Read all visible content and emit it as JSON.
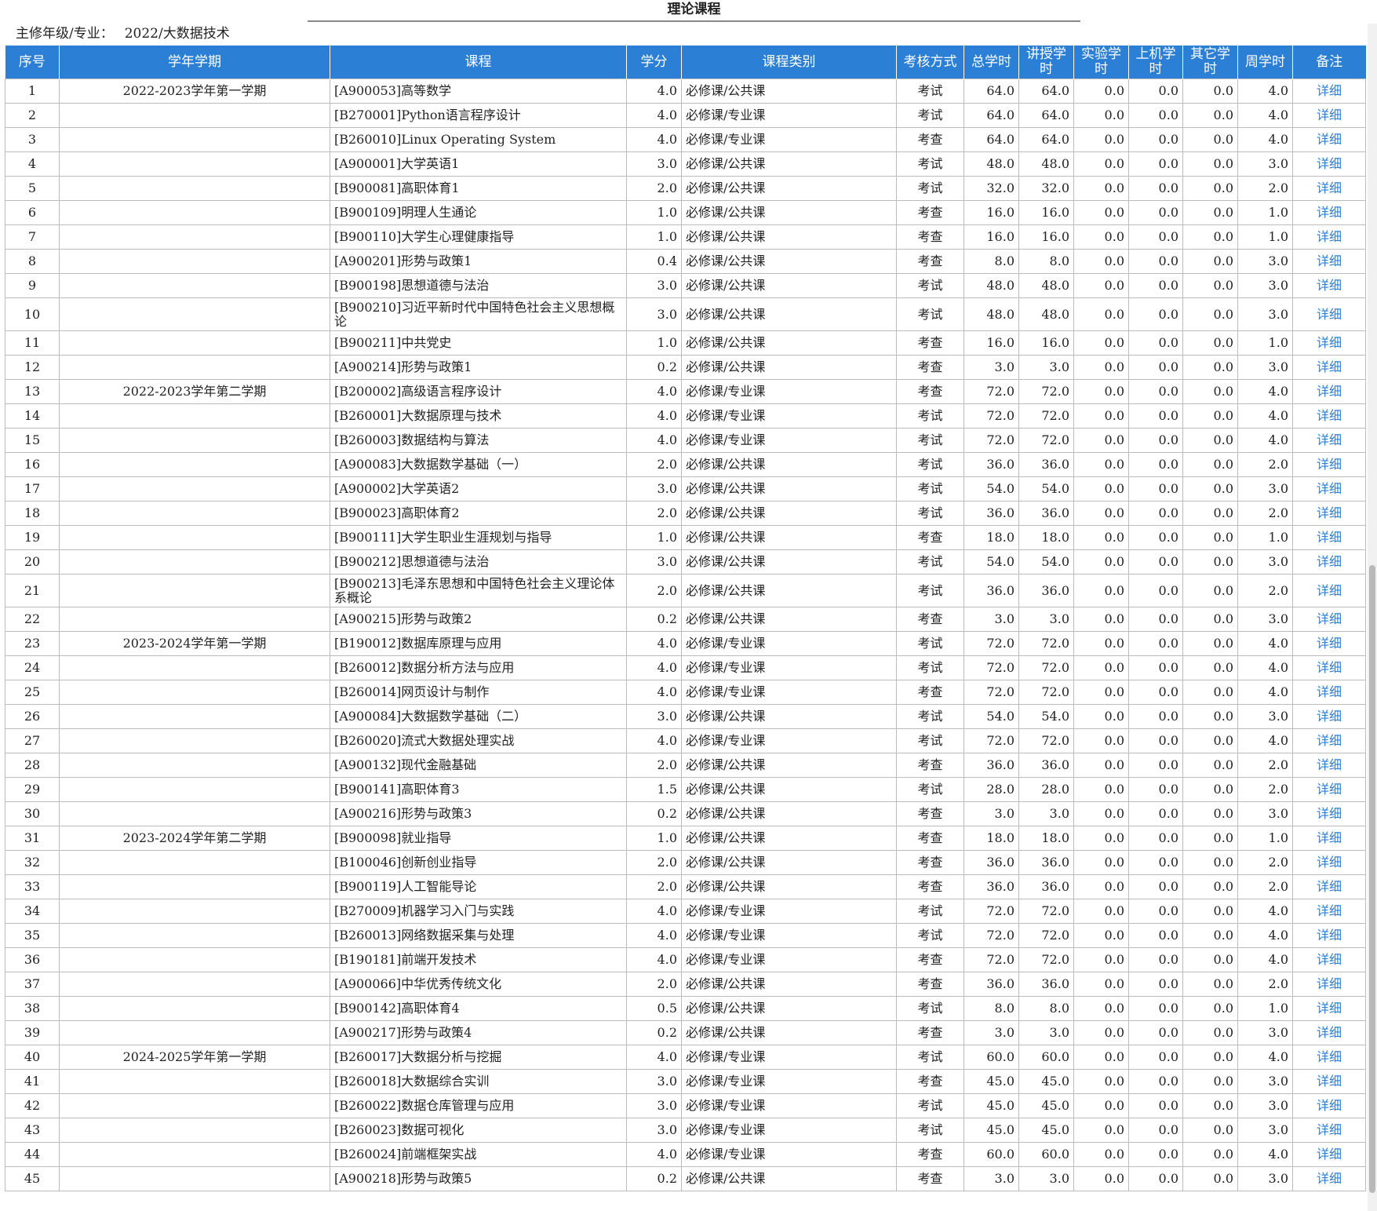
{
  "title": "理论课程",
  "meta": {
    "label": "主修年级/专业：",
    "value": "2022/大数据技术"
  },
  "columns": {
    "no": "序号",
    "semester": "学年学期",
    "course": "课程",
    "credit": "学分",
    "category": "课程类别",
    "exam": "考核方式",
    "total": "总学时",
    "lecture": "讲授学时",
    "lab": "实验学时",
    "computer": "上机学时",
    "other": "其它学时",
    "weekly": "周学时",
    "remark": "备注"
  },
  "detail_label": "详细",
  "rows": [
    {
      "no": "1",
      "semester": "2022-2023学年第一学期",
      "course": "[A900053]高等数学",
      "credit": "4.0",
      "category": "必修课/公共课",
      "exam": "考试",
      "total": "64.0",
      "lecture": "64.0",
      "lab": "0.0",
      "computer": "0.0",
      "other": "0.0",
      "weekly": "4.0"
    },
    {
      "no": "2",
      "semester": "",
      "course": "[B270001]Python语言程序设计",
      "credit": "4.0",
      "category": "必修课/专业课",
      "exam": "考试",
      "total": "64.0",
      "lecture": "64.0",
      "lab": "0.0",
      "computer": "0.0",
      "other": "0.0",
      "weekly": "4.0"
    },
    {
      "no": "3",
      "semester": "",
      "course": "[B260010]Linux Operating System",
      "credit": "4.0",
      "category": "必修课/专业课",
      "exam": "考查",
      "total": "64.0",
      "lecture": "64.0",
      "lab": "0.0",
      "computer": "0.0",
      "other": "0.0",
      "weekly": "4.0"
    },
    {
      "no": "4",
      "semester": "",
      "course": "[A900001]大学英语1",
      "credit": "3.0",
      "category": "必修课/公共课",
      "exam": "考试",
      "total": "48.0",
      "lecture": "48.0",
      "lab": "0.0",
      "computer": "0.0",
      "other": "0.0",
      "weekly": "3.0"
    },
    {
      "no": "5",
      "semester": "",
      "course": "[B900081]高职体育1",
      "credit": "2.0",
      "category": "必修课/公共课",
      "exam": "考试",
      "total": "32.0",
      "lecture": "32.0",
      "lab": "0.0",
      "computer": "0.0",
      "other": "0.0",
      "weekly": "2.0"
    },
    {
      "no": "6",
      "semester": "",
      "course": "[B900109]明理人生通论",
      "credit": "1.0",
      "category": "必修课/公共课",
      "exam": "考查",
      "total": "16.0",
      "lecture": "16.0",
      "lab": "0.0",
      "computer": "0.0",
      "other": "0.0",
      "weekly": "1.0"
    },
    {
      "no": "7",
      "semester": "",
      "course": "[B900110]大学生心理健康指导",
      "credit": "1.0",
      "category": "必修课/公共课",
      "exam": "考查",
      "total": "16.0",
      "lecture": "16.0",
      "lab": "0.0",
      "computer": "0.0",
      "other": "0.0",
      "weekly": "1.0"
    },
    {
      "no": "8",
      "semester": "",
      "course": "[A900201]形势与政策1",
      "credit": "0.4",
      "category": "必修课/公共课",
      "exam": "考查",
      "total": "8.0",
      "lecture": "8.0",
      "lab": "0.0",
      "computer": "0.0",
      "other": "0.0",
      "weekly": "3.0"
    },
    {
      "no": "9",
      "semester": "",
      "course": "[B900198]思想道德与法治",
      "credit": "3.0",
      "category": "必修课/公共课",
      "exam": "考试",
      "total": "48.0",
      "lecture": "48.0",
      "lab": "0.0",
      "computer": "0.0",
      "other": "0.0",
      "weekly": "3.0"
    },
    {
      "no": "10",
      "semester": "",
      "course": "[B900210]习近平新时代中国特色社会主义思想概论",
      "credit": "3.0",
      "category": "必修课/公共课",
      "exam": "考试",
      "total": "48.0",
      "lecture": "48.0",
      "lab": "0.0",
      "computer": "0.0",
      "other": "0.0",
      "weekly": "3.0",
      "tall": true
    },
    {
      "no": "11",
      "semester": "",
      "course": "[B900211]中共党史",
      "credit": "1.0",
      "category": "必修课/公共课",
      "exam": "考查",
      "total": "16.0",
      "lecture": "16.0",
      "lab": "0.0",
      "computer": "0.0",
      "other": "0.0",
      "weekly": "1.0"
    },
    {
      "no": "12",
      "semester": "",
      "course": "[A900214]形势与政策1",
      "credit": "0.2",
      "category": "必修课/公共课",
      "exam": "考查",
      "total": "3.0",
      "lecture": "3.0",
      "lab": "0.0",
      "computer": "0.0",
      "other": "0.0",
      "weekly": "3.0"
    },
    {
      "no": "13",
      "semester": "2022-2023学年第二学期",
      "course": "[B200002]高级语言程序设计",
      "credit": "4.0",
      "category": "必修课/专业课",
      "exam": "考查",
      "total": "72.0",
      "lecture": "72.0",
      "lab": "0.0",
      "computer": "0.0",
      "other": "0.0",
      "weekly": "4.0"
    },
    {
      "no": "14",
      "semester": "",
      "course": "[B260001]大数据原理与技术",
      "credit": "4.0",
      "category": "必修课/专业课",
      "exam": "考试",
      "total": "72.0",
      "lecture": "72.0",
      "lab": "0.0",
      "computer": "0.0",
      "other": "0.0",
      "weekly": "4.0"
    },
    {
      "no": "15",
      "semester": "",
      "course": "[B260003]数据结构与算法",
      "credit": "4.0",
      "category": "必修课/专业课",
      "exam": "考试",
      "total": "72.0",
      "lecture": "72.0",
      "lab": "0.0",
      "computer": "0.0",
      "other": "0.0",
      "weekly": "4.0"
    },
    {
      "no": "16",
      "semester": "",
      "course": "[A900083]大数据数学基础（一）",
      "credit": "2.0",
      "category": "必修课/公共课",
      "exam": "考试",
      "total": "36.0",
      "lecture": "36.0",
      "lab": "0.0",
      "computer": "0.0",
      "other": "0.0",
      "weekly": "2.0"
    },
    {
      "no": "17",
      "semester": "",
      "course": "[A900002]大学英语2",
      "credit": "3.0",
      "category": "必修课/公共课",
      "exam": "考试",
      "total": "54.0",
      "lecture": "54.0",
      "lab": "0.0",
      "computer": "0.0",
      "other": "0.0",
      "weekly": "3.0"
    },
    {
      "no": "18",
      "semester": "",
      "course": "[B900023]高职体育2",
      "credit": "2.0",
      "category": "必修课/公共课",
      "exam": "考试",
      "total": "36.0",
      "lecture": "36.0",
      "lab": "0.0",
      "computer": "0.0",
      "other": "0.0",
      "weekly": "2.0"
    },
    {
      "no": "19",
      "semester": "",
      "course": "[B900111]大学生职业生涯规划与指导",
      "credit": "1.0",
      "category": "必修课/公共课",
      "exam": "考查",
      "total": "18.0",
      "lecture": "18.0",
      "lab": "0.0",
      "computer": "0.0",
      "other": "0.0",
      "weekly": "1.0"
    },
    {
      "no": "20",
      "semester": "",
      "course": "[B900212]思想道德与法治",
      "credit": "3.0",
      "category": "必修课/公共课",
      "exam": "考试",
      "total": "54.0",
      "lecture": "54.0",
      "lab": "0.0",
      "computer": "0.0",
      "other": "0.0",
      "weekly": "3.0"
    },
    {
      "no": "21",
      "semester": "",
      "course": "[B900213]毛泽东思想和中国特色社会主义理论体系概论",
      "credit": "2.0",
      "category": "必修课/公共课",
      "exam": "考试",
      "total": "36.0",
      "lecture": "36.0",
      "lab": "0.0",
      "computer": "0.0",
      "other": "0.0",
      "weekly": "2.0",
      "tall": true
    },
    {
      "no": "22",
      "semester": "",
      "course": "[A900215]形势与政策2",
      "credit": "0.2",
      "category": "必修课/公共课",
      "exam": "考查",
      "total": "3.0",
      "lecture": "3.0",
      "lab": "0.0",
      "computer": "0.0",
      "other": "0.0",
      "weekly": "3.0"
    },
    {
      "no": "23",
      "semester": "2023-2024学年第一学期",
      "course": "[B190012]数据库原理与应用",
      "credit": "4.0",
      "category": "必修课/专业课",
      "exam": "考试",
      "total": "72.0",
      "lecture": "72.0",
      "lab": "0.0",
      "computer": "0.0",
      "other": "0.0",
      "weekly": "4.0"
    },
    {
      "no": "24",
      "semester": "",
      "course": "[B260012]数据分析方法与应用",
      "credit": "4.0",
      "category": "必修课/专业课",
      "exam": "考试",
      "total": "72.0",
      "lecture": "72.0",
      "lab": "0.0",
      "computer": "0.0",
      "other": "0.0",
      "weekly": "4.0"
    },
    {
      "no": "25",
      "semester": "",
      "course": "[B260014]网页设计与制作",
      "credit": "4.0",
      "category": "必修课/专业课",
      "exam": "考查",
      "total": "72.0",
      "lecture": "72.0",
      "lab": "0.0",
      "computer": "0.0",
      "other": "0.0",
      "weekly": "4.0"
    },
    {
      "no": "26",
      "semester": "",
      "course": "[A900084]大数据数学基础（二）",
      "credit": "3.0",
      "category": "必修课/公共课",
      "exam": "考试",
      "total": "54.0",
      "lecture": "54.0",
      "lab": "0.0",
      "computer": "0.0",
      "other": "0.0",
      "weekly": "3.0"
    },
    {
      "no": "27",
      "semester": "",
      "course": "[B260020]流式大数据处理实战",
      "credit": "4.0",
      "category": "必修课/专业课",
      "exam": "考试",
      "total": "72.0",
      "lecture": "72.0",
      "lab": "0.0",
      "computer": "0.0",
      "other": "0.0",
      "weekly": "4.0"
    },
    {
      "no": "28",
      "semester": "",
      "course": "[A900132]现代金融基础",
      "credit": "2.0",
      "category": "必修课/公共课",
      "exam": "考查",
      "total": "36.0",
      "lecture": "36.0",
      "lab": "0.0",
      "computer": "0.0",
      "other": "0.0",
      "weekly": "2.0"
    },
    {
      "no": "29",
      "semester": "",
      "course": "[B900141]高职体育3",
      "credit": "1.5",
      "category": "必修课/公共课",
      "exam": "考试",
      "total": "28.0",
      "lecture": "28.0",
      "lab": "0.0",
      "computer": "0.0",
      "other": "0.0",
      "weekly": "2.0"
    },
    {
      "no": "30",
      "semester": "",
      "course": "[A900216]形势与政策3",
      "credit": "0.2",
      "category": "必修课/公共课",
      "exam": "考查",
      "total": "3.0",
      "lecture": "3.0",
      "lab": "0.0",
      "computer": "0.0",
      "other": "0.0",
      "weekly": "3.0"
    },
    {
      "no": "31",
      "semester": "2023-2024学年第二学期",
      "course": "[B900098]就业指导",
      "credit": "1.0",
      "category": "必修课/公共课",
      "exam": "考查",
      "total": "18.0",
      "lecture": "18.0",
      "lab": "0.0",
      "computer": "0.0",
      "other": "0.0",
      "weekly": "1.0"
    },
    {
      "no": "32",
      "semester": "",
      "course": "[B100046]创新创业指导",
      "credit": "2.0",
      "category": "必修课/公共课",
      "exam": "考查",
      "total": "36.0",
      "lecture": "36.0",
      "lab": "0.0",
      "computer": "0.0",
      "other": "0.0",
      "weekly": "2.0"
    },
    {
      "no": "33",
      "semester": "",
      "course": "[B900119]人工智能导论",
      "credit": "2.0",
      "category": "必修课/公共课",
      "exam": "考查",
      "total": "36.0",
      "lecture": "36.0",
      "lab": "0.0",
      "computer": "0.0",
      "other": "0.0",
      "weekly": "2.0"
    },
    {
      "no": "34",
      "semester": "",
      "course": "[B270009]机器学习入门与实践",
      "credit": "4.0",
      "category": "必修课/专业课",
      "exam": "考试",
      "total": "72.0",
      "lecture": "72.0",
      "lab": "0.0",
      "computer": "0.0",
      "other": "0.0",
      "weekly": "4.0"
    },
    {
      "no": "35",
      "semester": "",
      "course": "[B260013]网络数据采集与处理",
      "credit": "4.0",
      "category": "必修课/专业课",
      "exam": "考试",
      "total": "72.0",
      "lecture": "72.0",
      "lab": "0.0",
      "computer": "0.0",
      "other": "0.0",
      "weekly": "4.0"
    },
    {
      "no": "36",
      "semester": "",
      "course": "[B190181]前端开发技术",
      "credit": "4.0",
      "category": "必修课/专业课",
      "exam": "考查",
      "total": "72.0",
      "lecture": "72.0",
      "lab": "0.0",
      "computer": "0.0",
      "other": "0.0",
      "weekly": "4.0"
    },
    {
      "no": "37",
      "semester": "",
      "course": "[A900066]中华优秀传统文化",
      "credit": "2.0",
      "category": "必修课/公共课",
      "exam": "考查",
      "total": "36.0",
      "lecture": "36.0",
      "lab": "0.0",
      "computer": "0.0",
      "other": "0.0",
      "weekly": "2.0"
    },
    {
      "no": "38",
      "semester": "",
      "course": "[B900142]高职体育4",
      "credit": "0.5",
      "category": "必修课/公共课",
      "exam": "考试",
      "total": "8.0",
      "lecture": "8.0",
      "lab": "0.0",
      "computer": "0.0",
      "other": "0.0",
      "weekly": "1.0"
    },
    {
      "no": "39",
      "semester": "",
      "course": "[A900217]形势与政策4",
      "credit": "0.2",
      "category": "必修课/公共课",
      "exam": "考查",
      "total": "3.0",
      "lecture": "3.0",
      "lab": "0.0",
      "computer": "0.0",
      "other": "0.0",
      "weekly": "3.0"
    },
    {
      "no": "40",
      "semester": "2024-2025学年第一学期",
      "course": "[B260017]大数据分析与挖掘",
      "credit": "4.0",
      "category": "必修课/专业课",
      "exam": "考试",
      "total": "60.0",
      "lecture": "60.0",
      "lab": "0.0",
      "computer": "0.0",
      "other": "0.0",
      "weekly": "4.0"
    },
    {
      "no": "41",
      "semester": "",
      "course": "[B260018]大数据综合实训",
      "credit": "3.0",
      "category": "必修课/专业课",
      "exam": "考查",
      "total": "45.0",
      "lecture": "45.0",
      "lab": "0.0",
      "computer": "0.0",
      "other": "0.0",
      "weekly": "3.0"
    },
    {
      "no": "42",
      "semester": "",
      "course": "[B260022]数据仓库管理与应用",
      "credit": "3.0",
      "category": "必修课/专业课",
      "exam": "考试",
      "total": "45.0",
      "lecture": "45.0",
      "lab": "0.0",
      "computer": "0.0",
      "other": "0.0",
      "weekly": "3.0"
    },
    {
      "no": "43",
      "semester": "",
      "course": "[B260023]数据可视化",
      "credit": "3.0",
      "category": "必修课/专业课",
      "exam": "考试",
      "total": "45.0",
      "lecture": "45.0",
      "lab": "0.0",
      "computer": "0.0",
      "other": "0.0",
      "weekly": "3.0"
    },
    {
      "no": "44",
      "semester": "",
      "course": "[B260024]前端框架实战",
      "credit": "4.0",
      "category": "必修课/专业课",
      "exam": "考查",
      "total": "60.0",
      "lecture": "60.0",
      "lab": "0.0",
      "computer": "0.0",
      "other": "0.0",
      "weekly": "4.0"
    },
    {
      "no": "45",
      "semester": "",
      "course": "[A900218]形势与政策5",
      "credit": "0.2",
      "category": "必修课/公共课",
      "exam": "考查",
      "total": "3.0",
      "lecture": "3.0",
      "lab": "0.0",
      "computer": "0.0",
      "other": "0.0",
      "weekly": "3.0"
    }
  ]
}
